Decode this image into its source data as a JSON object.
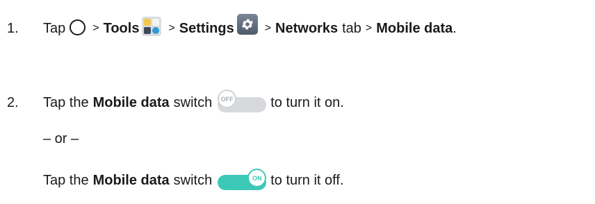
{
  "step1": {
    "number": "1.",
    "tap": "Tap",
    "sep": ">",
    "tools": "Tools",
    "settings": "Settings",
    "networks": "Networks",
    "tab": "tab",
    "mobile_data": "Mobile data",
    "period": "."
  },
  "step2": {
    "number": "2.",
    "tap_the": "Tap the",
    "mobile_data": "Mobile data",
    "switch_word": "switch",
    "turn_on": "to turn it on."
  },
  "or_text": "– or –",
  "step3": {
    "tap_the": "Tap the",
    "mobile_data": "Mobile data",
    "switch_word": "switch",
    "turn_off": "to turn it off."
  },
  "switch_off_label": "OFF",
  "switch_on_label": "ON",
  "icons": {
    "home": "home-circle-icon",
    "tools": "tools-folder-icon",
    "settings": "gear-icon"
  },
  "colors": {
    "switch_on": "#3cc8b7",
    "switch_off": "#d7d9dc"
  }
}
